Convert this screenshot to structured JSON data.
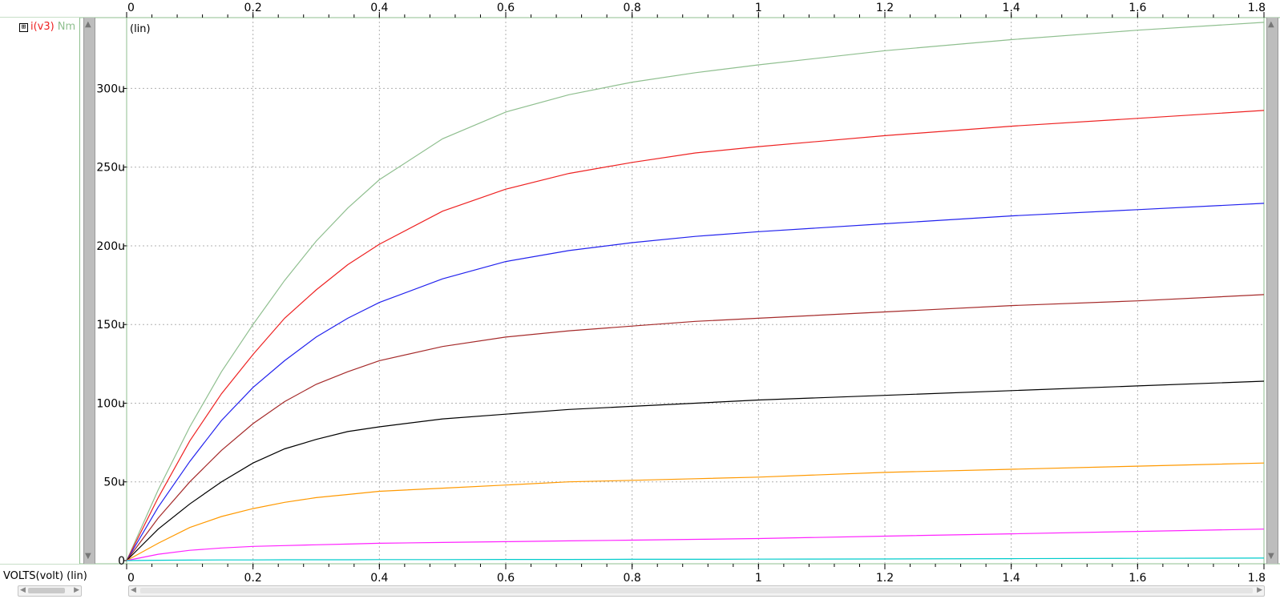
{
  "legend": {
    "expand_glyph": "⊞",
    "signal": "i(v3)",
    "curve": "Nm"
  },
  "x_axis_name": "VOLTS(volt) (lin)",
  "chart_data": {
    "type": "line",
    "title": "",
    "xlabel": "VOLTS(volt) (lin)",
    "ylabel": "(lin)",
    "xlim": [
      0,
      1.8
    ],
    "ylim": [
      0,
      345
    ],
    "x_ticks": [
      0,
      0.2,
      0.4,
      0.6,
      0.8,
      1,
      1.2,
      1.4,
      1.6,
      1.8
    ],
    "x_tick_labels": [
      "0",
      "0.2",
      "0.4",
      "0.6",
      "0.8",
      "1",
      "1.2",
      "1.4",
      "1.6",
      "1.8"
    ],
    "y_ticks": [
      0,
      50,
      100,
      150,
      200,
      250,
      300
    ],
    "y_tick_labels": [
      "0",
      "50u",
      "100u",
      "150u",
      "200u",
      "250u",
      "300u"
    ],
    "y_unit_scale": "u",
    "grid": true,
    "legend_position": "top-left",
    "x": [
      0,
      0.05,
      0.1,
      0.15,
      0.2,
      0.25,
      0.3,
      0.35,
      0.4,
      0.5,
      0.6,
      0.7,
      0.8,
      0.9,
      1.0,
      1.2,
      1.4,
      1.6,
      1.8
    ],
    "series": [
      {
        "color": "#8fbf8f",
        "values": [
          0,
          45,
          85,
          120,
          150,
          178,
          203,
          224,
          242,
          268,
          285,
          296,
          304,
          310,
          315,
          324,
          331,
          337,
          342
        ]
      },
      {
        "color": "#ee2222",
        "values": [
          0,
          40,
          76,
          106,
          131,
          154,
          172,
          188,
          201,
          222,
          236,
          246,
          253,
          259,
          263,
          270,
          276,
          281,
          286
        ]
      },
      {
        "color": "#2222ee",
        "values": [
          0,
          34,
          63,
          89,
          110,
          127,
          142,
          154,
          164,
          179,
          190,
          197,
          202,
          206,
          209,
          214,
          219,
          223,
          227
        ]
      },
      {
        "color": "#a52a2a",
        "values": [
          0,
          27,
          50,
          70,
          87,
          101,
          112,
          120,
          127,
          136,
          142,
          146,
          149,
          152,
          154,
          158,
          162,
          165,
          169
        ]
      },
      {
        "color": "#000000",
        "values": [
          0,
          20,
          36,
          50,
          62,
          71,
          77,
          82,
          85,
          90,
          93,
          96,
          98,
          100,
          102,
          105,
          108,
          111,
          114
        ]
      },
      {
        "color": "#ff9900",
        "values": [
          0,
          11,
          21,
          28,
          33,
          37,
          40,
          42,
          44,
          46,
          48,
          50,
          51,
          52,
          53,
          56,
          58,
          60,
          62
        ]
      },
      {
        "color": "#ff22ff",
        "values": [
          0,
          4,
          6.5,
          8,
          9,
          9.5,
          10,
          10.5,
          11,
          11.5,
          12,
          12.5,
          13,
          13.5,
          14,
          15.5,
          17,
          18.5,
          20
        ]
      },
      {
        "color": "#00cccc",
        "values": [
          0,
          0.2,
          0.3,
          0.4,
          0.4,
          0.5,
          0.5,
          0.5,
          0.6,
          0.6,
          0.7,
          0.7,
          0.8,
          0.8,
          0.9,
          1.0,
          1.2,
          1.4,
          1.6
        ]
      }
    ]
  }
}
